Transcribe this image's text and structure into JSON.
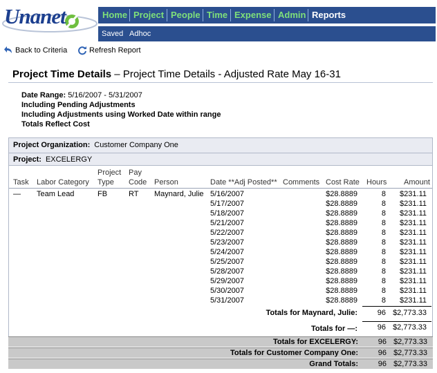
{
  "brand": {
    "logo_text": "Unanet"
  },
  "nav": {
    "items": [
      {
        "label": "Home"
      },
      {
        "label": "Project"
      },
      {
        "label": "People"
      },
      {
        "label": "Time"
      },
      {
        "label": "Expense"
      },
      {
        "label": "Admin"
      },
      {
        "label": "Reports"
      }
    ],
    "active": "Reports",
    "sub_items": [
      {
        "label": "Saved"
      },
      {
        "label": "Adhoc"
      }
    ]
  },
  "toolbar": {
    "back_label": "Back to Criteria",
    "refresh_label": "Refresh Report"
  },
  "report": {
    "title_main": "Project Time Details",
    "title_sep": "–",
    "title_sub": "Project Time Details - Adjusted Rate May 16-31",
    "criteria": {
      "date_range_label": "Date Range:",
      "date_range_value": "5/16/2007 - 5/31/2007",
      "line2": "Including Pending Adjustments",
      "line3": "Including Adjustments using Worked Date within range",
      "line4": "Totals Reflect Cost"
    },
    "org_label": "Project Organization:",
    "org_value": "Customer Company One",
    "project_label": "Project:",
    "project_value": "EXCELERGY",
    "columns": {
      "task": "Task",
      "labor": "Labor Category",
      "ptype_1": "Project",
      "ptype_2": "Type",
      "pay_1": "Pay",
      "pay_2": "Code",
      "person": "Person",
      "date": "Date **Adj Posted**",
      "comments": "Comments",
      "rate": "Cost Rate",
      "hours": "Hours",
      "amount": "Amount"
    },
    "first_row": {
      "task": "—",
      "labor": "Team Lead",
      "ptype": "FB",
      "pay": "RT",
      "person": "Maynard, Julie"
    },
    "rows": [
      {
        "date": "5/16/2007",
        "rate": "$28.8889",
        "hours": "8",
        "amount": "$231.11"
      },
      {
        "date": "5/17/2007",
        "rate": "$28.8889",
        "hours": "8",
        "amount": "$231.11"
      },
      {
        "date": "5/18/2007",
        "rate": "$28.8889",
        "hours": "8",
        "amount": "$231.11"
      },
      {
        "date": "5/21/2007",
        "rate": "$28.8889",
        "hours": "8",
        "amount": "$231.11"
      },
      {
        "date": "5/22/2007",
        "rate": "$28.8889",
        "hours": "8",
        "amount": "$231.11"
      },
      {
        "date": "5/23/2007",
        "rate": "$28.8889",
        "hours": "8",
        "amount": "$231.11"
      },
      {
        "date": "5/24/2007",
        "rate": "$28.8889",
        "hours": "8",
        "amount": "$231.11"
      },
      {
        "date": "5/25/2007",
        "rate": "$28.8889",
        "hours": "8",
        "amount": "$231.11"
      },
      {
        "date": "5/28/2007",
        "rate": "$28.8889",
        "hours": "8",
        "amount": "$231.11"
      },
      {
        "date": "5/29/2007",
        "rate": "$28.8889",
        "hours": "8",
        "amount": "$231.11"
      },
      {
        "date": "5/30/2007",
        "rate": "$28.8889",
        "hours": "8",
        "amount": "$231.11"
      },
      {
        "date": "5/31/2007",
        "rate": "$28.8889",
        "hours": "8",
        "amount": "$231.11"
      }
    ],
    "totals": [
      {
        "label": "Totals for Maynard, Julie:",
        "hours": "96",
        "amount": "$2,773.33"
      },
      {
        "label": "Totals for —:",
        "hours": "96",
        "amount": "$2,773.33"
      },
      {
        "label": "Totals for EXCELERGY:",
        "hours": "96",
        "amount": "$2,773.33"
      },
      {
        "label": "Totals for Customer Company One:",
        "hours": "96",
        "amount": "$2,773.33"
      },
      {
        "label": "Grand Totals:",
        "hours": "96",
        "amount": "$2,773.33"
      }
    ]
  },
  "colors": {
    "nav_bg": "#2b4f8f",
    "nav_link": "#7fe07a",
    "band_bg": "#e9ebf2",
    "total_bg": "#c9c9c9"
  }
}
